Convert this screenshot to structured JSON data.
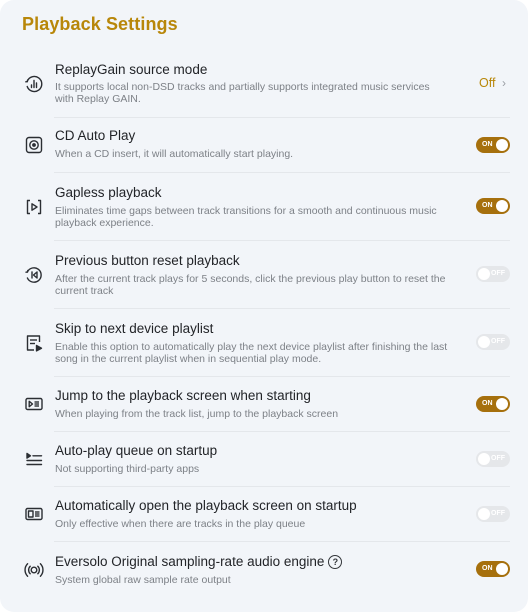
{
  "header": {
    "title": "Playback Settings"
  },
  "colors": {
    "accent": "#b8870a",
    "toggle_on": "#a6700d",
    "toggle_off": "#e5e7ea"
  },
  "settings": [
    {
      "title": "ReplayGain source mode",
      "desc": "It supports local non-DSD tracks and partially supports integrated music services with Replay GAIN.",
      "control": "value",
      "value": "Off",
      "icon": "replaygain-icon"
    },
    {
      "title": "CD Auto Play",
      "desc": "When a CD insert, it will automatically start playing.",
      "control": "toggle",
      "state": "ON",
      "icon": "cd-icon"
    },
    {
      "title": "Gapless playback",
      "desc": "Eliminates time gaps between track transitions for a smooth and continuous music playback experience.",
      "control": "toggle",
      "state": "ON",
      "icon": "gapless-icon"
    },
    {
      "title": "Previous button reset playback",
      "desc": "After the current track plays for 5 seconds, click the previous play button to reset the current track",
      "control": "toggle",
      "state": "OFF",
      "icon": "previous-reset-icon"
    },
    {
      "title": "Skip to next device playlist",
      "desc": "Enable this option to automatically play the next device playlist after finishing the last song in the current playlist when in sequential play mode.",
      "control": "toggle",
      "state": "OFF",
      "icon": "playlist-icon"
    },
    {
      "title": "Jump to the playback screen when starting",
      "desc": "When playing from the track list, jump to the playback screen",
      "control": "toggle",
      "state": "ON",
      "icon": "playback-screen-icon"
    },
    {
      "title": "Auto-play queue on startup",
      "desc": "Not supporting third-party apps",
      "control": "toggle",
      "state": "OFF",
      "icon": "queue-icon"
    },
    {
      "title": "Automatically open the playback screen on startup",
      "desc": "Only effective when there are tracks in the play queue",
      "control": "toggle",
      "state": "OFF",
      "icon": "open-screen-icon"
    },
    {
      "title": "Eversolo Original sampling-rate audio engine",
      "desc": "System global raw sample rate output",
      "control": "toggle",
      "state": "ON",
      "icon": "audio-engine-icon"
    }
  ]
}
